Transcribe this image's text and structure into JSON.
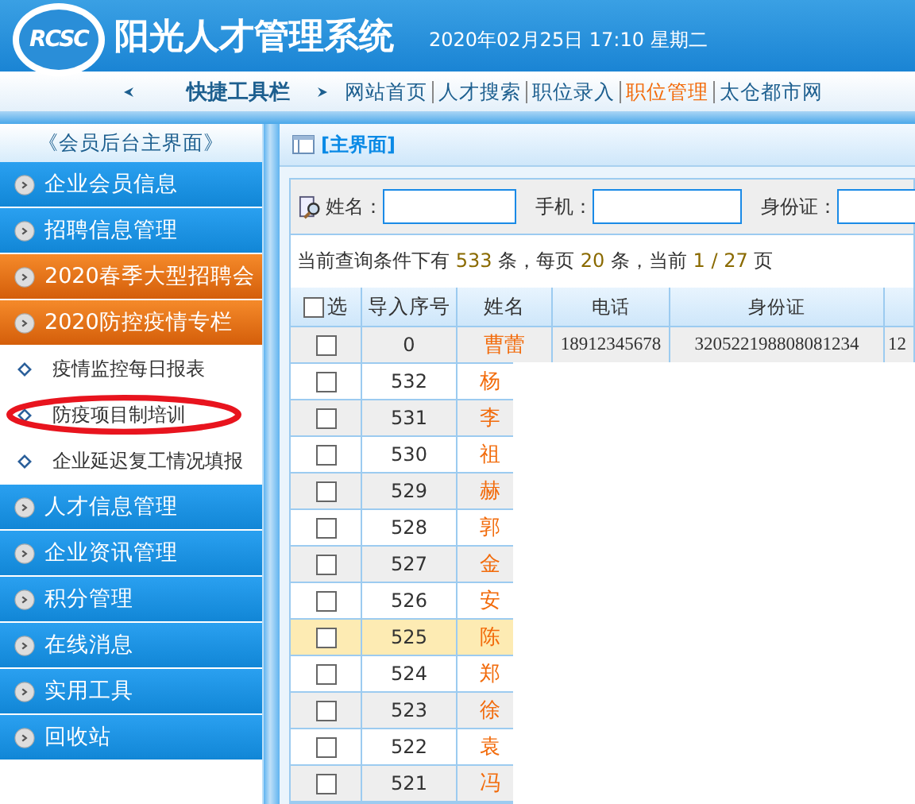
{
  "header": {
    "logo_text": "RCSC",
    "title": "阳光人才管理系统",
    "datetime": "2020年02月25日 17:10 星期二"
  },
  "toolbar": {
    "label": "快捷工具栏",
    "links": [
      {
        "label": "网站首页",
        "selected": false
      },
      {
        "label": "人才搜索",
        "selected": false
      },
      {
        "label": "职位录入",
        "selected": false
      },
      {
        "label": "职位管理",
        "selected": true
      },
      {
        "label": "太仓都市网",
        "selected": false
      }
    ]
  },
  "sidebar": {
    "title": "《会员后台主界面》",
    "items": [
      {
        "label": "企业会员信息",
        "kind": "blue"
      },
      {
        "label": "招聘信息管理",
        "kind": "blue"
      },
      {
        "label": "2020春季大型招聘会",
        "kind": "orange"
      },
      {
        "label": "2020防控疫情专栏",
        "kind": "orange",
        "children": [
          {
            "label": "疫情监控每日报表",
            "circled": false
          },
          {
            "label": "防疫项目制培训",
            "circled": true
          },
          {
            "label": "企业延迟复工情况填报",
            "circled": false
          }
        ]
      },
      {
        "label": "人才信息管理",
        "kind": "blue"
      },
      {
        "label": "企业资讯管理",
        "kind": "blue"
      },
      {
        "label": "积分管理",
        "kind": "blue"
      },
      {
        "label": "在线消息",
        "kind": "blue"
      },
      {
        "label": "实用工具",
        "kind": "blue"
      },
      {
        "label": "回收站",
        "kind": "blue"
      }
    ]
  },
  "main": {
    "title": "[主界面]",
    "search": [
      {
        "label": "姓名："
      },
      {
        "label": "手机："
      },
      {
        "label": "身份证："
      }
    ],
    "summary_parts": [
      "当前查询条件下有 ",
      "533",
      " 条，每页 ",
      "20",
      " 条，当前 ",
      "1 / 27",
      " 页"
    ],
    "table": {
      "select_all": {
        "label": "选",
        "checked": false
      },
      "columns": [
        "导入序号",
        "姓名",
        "电话",
        "身份证"
      ],
      "rows": [
        {
          "no": "0",
          "name": "曹蕾",
          "phone": "18912345678",
          "id": "320522198808081234",
          "column_6": "12",
          "checked": false,
          "highlighted": false
        },
        {
          "no": "532",
          "name": "杨",
          "checked": false,
          "highlighted": false
        },
        {
          "no": "531",
          "name": "李",
          "checked": false,
          "highlighted": false
        },
        {
          "no": "530",
          "name": "祖",
          "checked": false,
          "highlighted": false
        },
        {
          "no": "529",
          "name": "赫",
          "checked": false,
          "highlighted": false
        },
        {
          "no": "528",
          "name": "郭",
          "checked": false,
          "highlighted": false
        },
        {
          "no": "527",
          "name": "金",
          "checked": false,
          "highlighted": false
        },
        {
          "no": "526",
          "name": "安",
          "checked": false,
          "highlighted": false
        },
        {
          "no": "525",
          "name": "陈",
          "checked": false,
          "highlighted": true
        },
        {
          "no": "524",
          "name": "郑",
          "checked": false,
          "highlighted": false
        },
        {
          "no": "523",
          "name": "徐",
          "checked": false,
          "highlighted": false
        },
        {
          "no": "522",
          "name": "袁",
          "checked": false,
          "highlighted": false
        },
        {
          "no": "521",
          "name": "冯",
          "checked": false,
          "highlighted": false
        }
      ]
    }
  }
}
